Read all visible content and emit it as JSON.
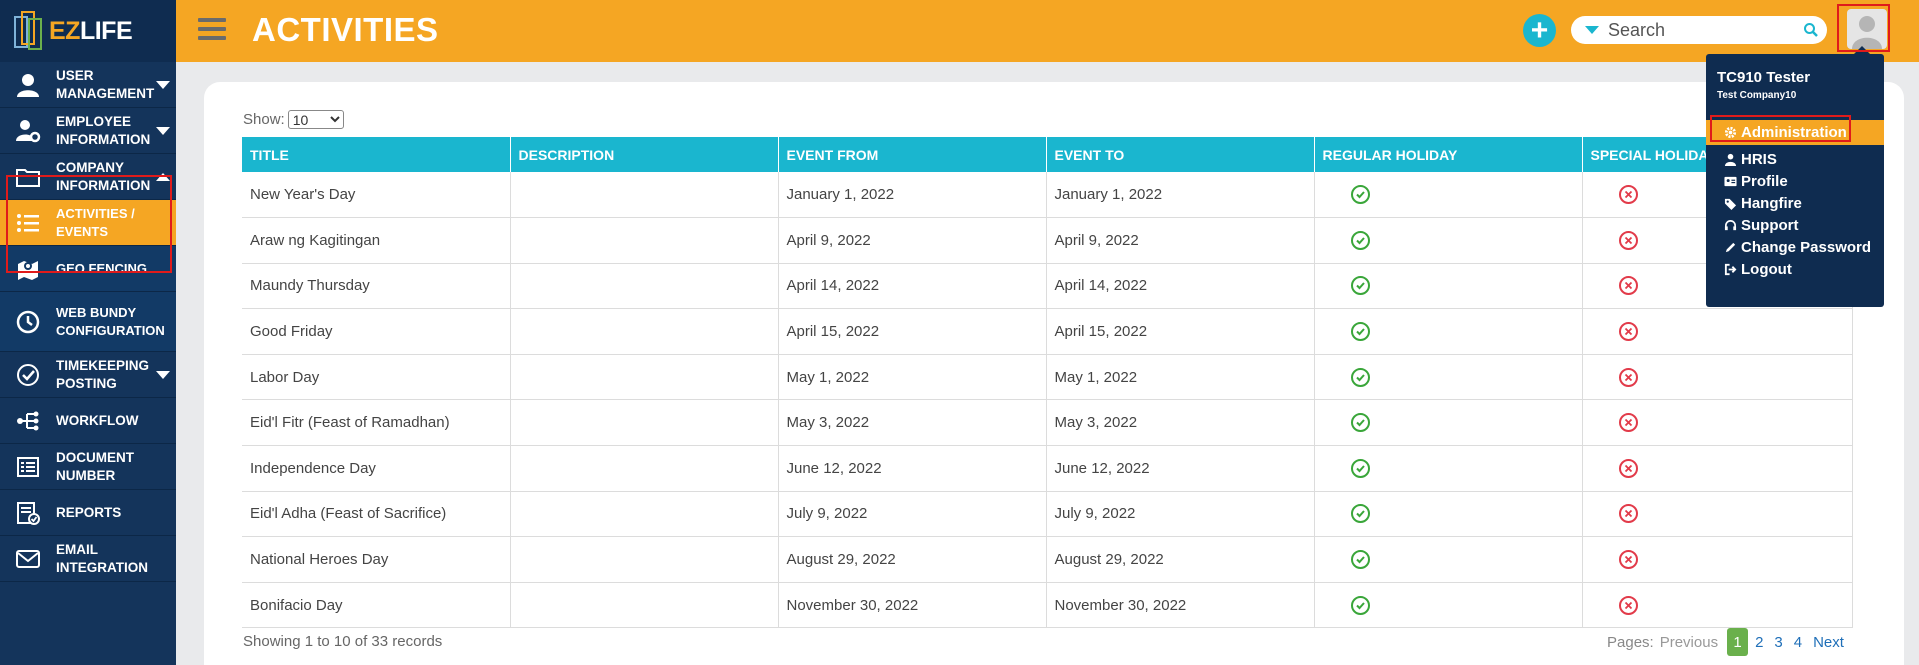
{
  "logo": {
    "ez": "EZ",
    "life": "LIFE"
  },
  "header": {
    "title": "ACTIVITIES",
    "search_placeholder": "Search"
  },
  "sidebar": {
    "items": [
      {
        "label_1": "USER",
        "label_2": "MANAGEMENT",
        "icon": "user-icon"
      },
      {
        "label_1": "EMPLOYEE",
        "label_2": "INFORMATION",
        "icon": "user-cog-icon"
      },
      {
        "label_1": "COMPANY",
        "label_2": "INFORMATION",
        "icon": "folder-icon"
      },
      {
        "label_1": "ACTIVITIES /",
        "label_2": "EVENTS",
        "icon": "list-icon"
      },
      {
        "label_1": "GEO FENCING",
        "label_2": "",
        "icon": "map-marker-icon"
      },
      {
        "label_1": "WEB BUNDY",
        "label_2": "CONFIGURATION",
        "icon": "clock-icon"
      },
      {
        "label_1": "TIMEKEEPING",
        "label_2": "POSTING",
        "icon": "check-circle-icon"
      },
      {
        "label_1": "WORKFLOW",
        "label_2": "",
        "icon": "workflow-icon"
      },
      {
        "label_1": "DOCUMENT",
        "label_2": "NUMBER",
        "icon": "document-list-icon"
      },
      {
        "label_1": "REPORTS",
        "label_2": "",
        "icon": "report-icon"
      },
      {
        "label_1": "EMAIL",
        "label_2": "INTEGRATION",
        "icon": "envelope-icon"
      }
    ]
  },
  "table": {
    "show_label": "Show:",
    "show_value": "10",
    "columns": [
      "TITLE",
      "DESCRIPTION",
      "EVENT FROM",
      "EVENT TO",
      "REGULAR HOLIDAY",
      "SPECIAL HOLIDAY"
    ],
    "rows": [
      {
        "title": "New Year's Day",
        "description": "",
        "from": "January 1, 2022",
        "to": "January 1, 2022",
        "regular": true,
        "special": false
      },
      {
        "title": "Araw ng Kagitingan",
        "description": "",
        "from": "April 9, 2022",
        "to": "April 9, 2022",
        "regular": true,
        "special": false
      },
      {
        "title": "Maundy Thursday",
        "description": "",
        "from": "April 14, 2022",
        "to": "April 14, 2022",
        "regular": true,
        "special": false
      },
      {
        "title": "Good Friday",
        "description": "",
        "from": "April 15, 2022",
        "to": "April 15, 2022",
        "regular": true,
        "special": false
      },
      {
        "title": "Labor Day",
        "description": "",
        "from": "May 1, 2022",
        "to": "May 1, 2022",
        "regular": true,
        "special": false
      },
      {
        "title": "Eid'l Fitr (Feast of Ramadhan)",
        "description": "",
        "from": "May 3, 2022",
        "to": "May 3, 2022",
        "regular": true,
        "special": false
      },
      {
        "title": "Independence Day",
        "description": "",
        "from": "June 12, 2022",
        "to": "June 12, 2022",
        "regular": true,
        "special": false
      },
      {
        "title": "Eid'l Adha (Feast of Sacrifice)",
        "description": "",
        "from": "July 9, 2022",
        "to": "July 9, 2022",
        "regular": true,
        "special": false
      },
      {
        "title": "National Heroes Day",
        "description": "",
        "from": "August 29, 2022",
        "to": "August 29, 2022",
        "regular": true,
        "special": false
      },
      {
        "title": "Bonifacio Day",
        "description": "",
        "from": "November 30, 2022",
        "to": "November 30, 2022",
        "regular": true,
        "special": false
      }
    ],
    "footer": "Showing 1 to 10 of 33 records"
  },
  "pagination": {
    "label": "Pages:",
    "previous": "Previous",
    "current": "1",
    "pages": [
      "2",
      "3",
      "4"
    ],
    "next": "Next"
  },
  "user_menu": {
    "name": "TC910 Tester",
    "company": "Test Company10",
    "items": [
      {
        "label": "Administration",
        "icon": "gear-icon"
      },
      {
        "label": "HRIS",
        "icon": "user-icon"
      },
      {
        "label": "Profile",
        "icon": "id-card-icon"
      },
      {
        "label": "Hangfire",
        "icon": "tags-icon"
      },
      {
        "label": "Support",
        "icon": "headset-icon"
      },
      {
        "label": "Change Password",
        "icon": "pencil-icon"
      },
      {
        "label": "Logout",
        "icon": "logout-icon"
      }
    ]
  },
  "colors": {
    "accent": "#f5a623",
    "sidebar": "#14345b",
    "table_header": "#1ab6cf",
    "ok": "#3aa63a",
    "no": "#e23b4a",
    "highlight_box": "#e01b1b"
  }
}
